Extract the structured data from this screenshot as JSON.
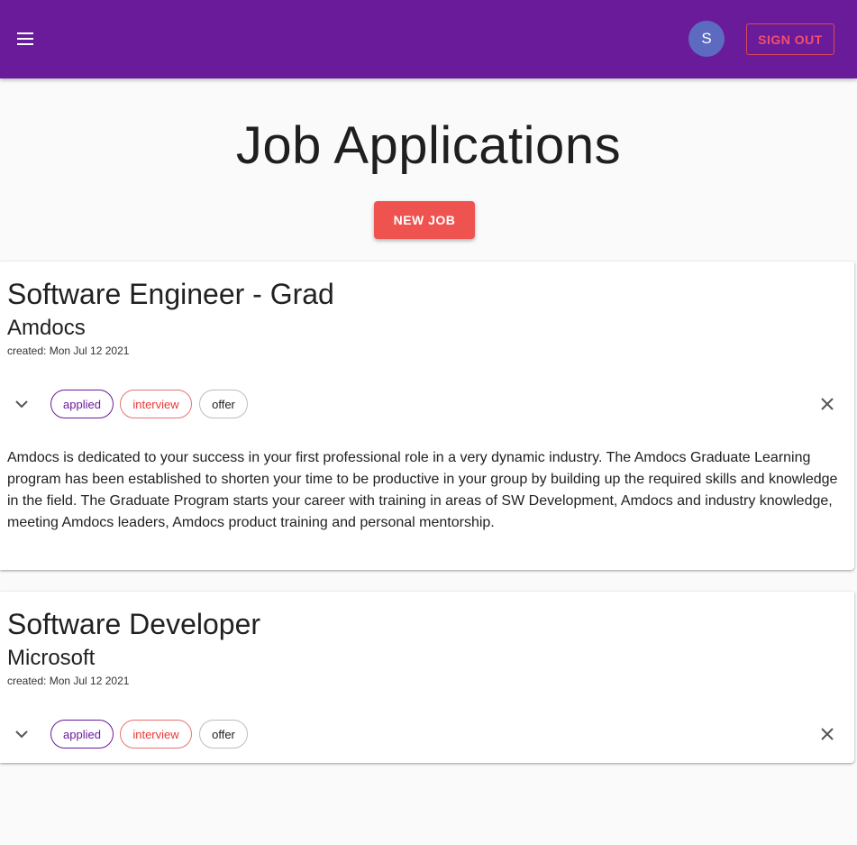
{
  "header": {
    "avatar_letter": "S",
    "signout_label": "SIGN OUT",
    "menu_icon": "menu-icon"
  },
  "main": {
    "title": "Job Applications",
    "new_job_label": "NEW JOB"
  },
  "jobs": [
    {
      "title": "Software Engineer - Grad",
      "company": "Amdocs",
      "created": "created: Mon Jul 12 2021",
      "chips": [
        "applied",
        "interview",
        "offer"
      ],
      "description": "Amdocs is dedicated to your success in your first professional role in a very dynamic industry. The Amdocs Graduate Learning program has been established to shorten your time to be productive in your group by building up the required skills and knowledge in the field. The Graduate Program starts your career with training in areas of SW Development, Amdocs and industry knowledge, meeting Amdocs leaders, Amdocs product training and personal mentorship."
    },
    {
      "title": "Software Developer",
      "company": "Microsoft",
      "created": "created: Mon Jul 12 2021",
      "chips": [
        "applied",
        "interview",
        "offer"
      ]
    }
  ],
  "colors": {
    "appbar": "#6a1b9a",
    "accent": "#ef5350",
    "avatar": "#5c6bc0"
  }
}
